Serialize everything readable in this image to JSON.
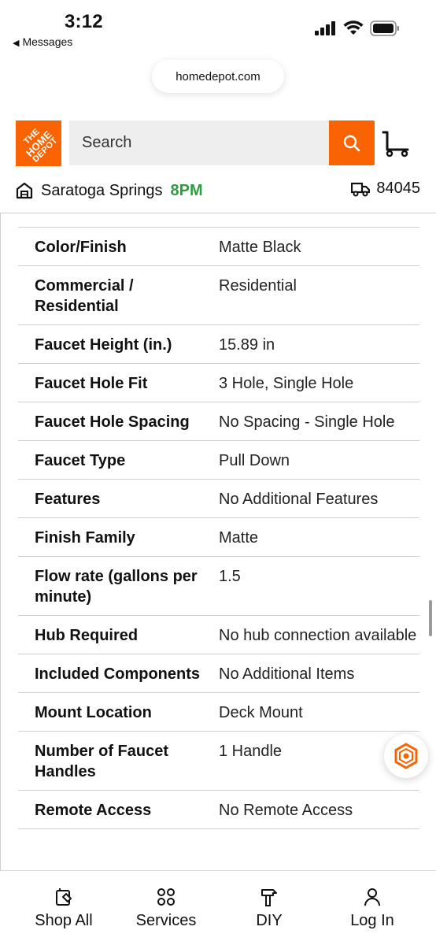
{
  "status_bar": {
    "time": "3:12",
    "back_label": "Messages"
  },
  "browser": {
    "url": "homedepot.com"
  },
  "header": {
    "logo_text_line1": "THE",
    "logo_text_line2": "HOME",
    "logo_text_line3": "DEPOT",
    "search_placeholder": "Search",
    "brand_color": "#f96302"
  },
  "store": {
    "name": "Saratoga Springs",
    "hours": "8PM",
    "zip": "84045",
    "hours_color": "#2e9c3f"
  },
  "specs": {
    "rows": [
      {
        "label": "Color/Finish",
        "value": "Matte Black"
      },
      {
        "label": "Commercial / Residential",
        "value": "Residential"
      },
      {
        "label": "Faucet Height (in.)",
        "value": "15.89 in"
      },
      {
        "label": "Faucet Hole Fit",
        "value": "3 Hole, Single Hole"
      },
      {
        "label": "Faucet Hole Spacing",
        "value": "No Spacing - Single Hole"
      },
      {
        "label": "Faucet Type",
        "value": "Pull Down"
      },
      {
        "label": "Features",
        "value": "No Additional Features"
      },
      {
        "label": "Finish Family",
        "value": "Matte"
      },
      {
        "label": "Flow rate (gallons per minute)",
        "value": "1.5"
      },
      {
        "label": "Hub Required",
        "value": "No hub connection available"
      },
      {
        "label": "Included Components",
        "value": "No Additional Items"
      },
      {
        "label": "Mount Location",
        "value": "Deck Mount"
      },
      {
        "label": "Number of Faucet Handles",
        "value": "1 Handle"
      },
      {
        "label": "Remote Access",
        "value": "No Remote Access"
      }
    ]
  },
  "bottom_nav": {
    "items": [
      {
        "label": "Shop All",
        "icon": "shop-all-icon"
      },
      {
        "label": "Services",
        "icon": "services-icon"
      },
      {
        "label": "DIY",
        "icon": "diy-hammer-icon"
      },
      {
        "label": "Log In",
        "icon": "person-icon"
      }
    ]
  }
}
